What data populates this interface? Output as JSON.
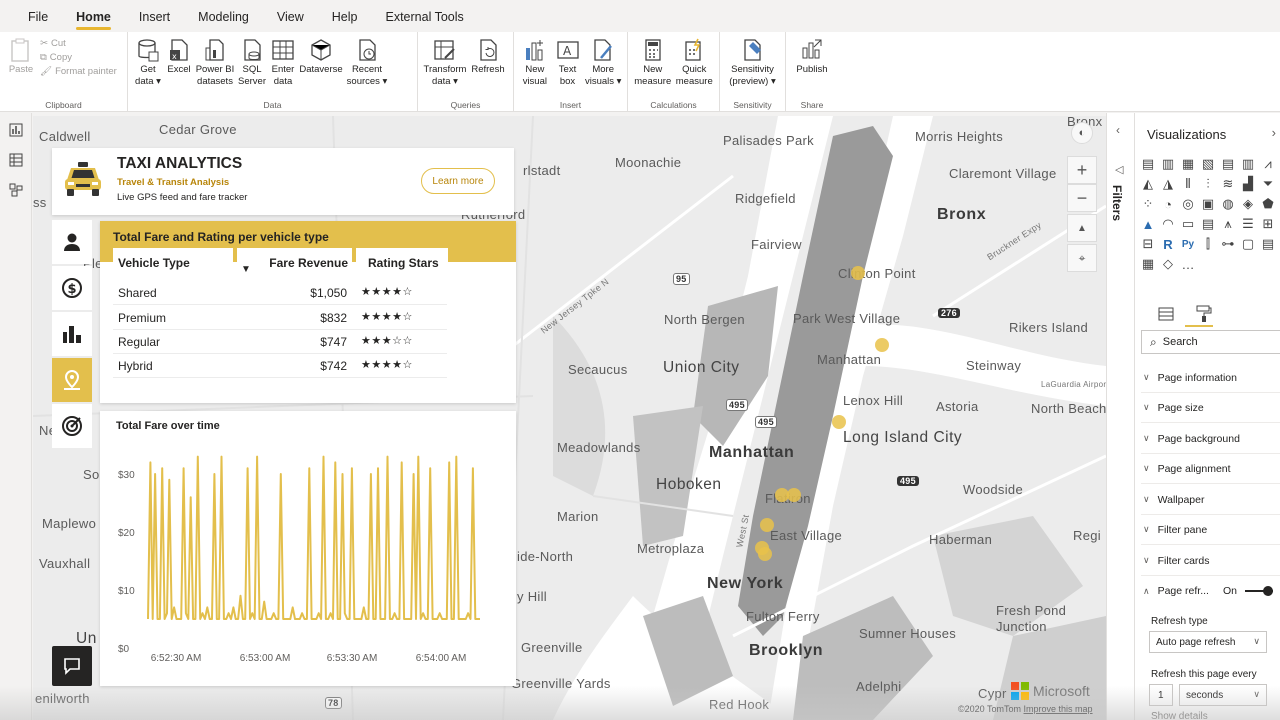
{
  "menu": {
    "tabs": [
      "File",
      "Home",
      "Insert",
      "Modeling",
      "View",
      "Help",
      "External Tools"
    ],
    "active": "Home"
  },
  "ribbon": {
    "clipboard": {
      "paste": "Paste",
      "cut": "Cut",
      "copy": "Copy",
      "format_painter": "Format painter",
      "label": "Clipboard"
    },
    "data": {
      "get_data": "Get\ndata ▾",
      "excel": "Excel",
      "power_bi": "Power BI\ndatasets",
      "sql": "SQL\nServer",
      "enter_data": "Enter\ndata",
      "dataverse": "Dataverse",
      "recent": "Recent\nsources ▾",
      "label": "Data"
    },
    "queries": {
      "transform": "Transform\ndata ▾",
      "refresh": "Refresh",
      "label": "Queries"
    },
    "insert": {
      "new_visual": "New\nvisual",
      "text_box": "Text\nbox",
      "more_visuals": "More\nvisuals ▾",
      "label": "Insert"
    },
    "calculations": {
      "new_measure": "New\nmeasure",
      "quick_measure": "Quick\nmeasure",
      "label": "Calculations"
    },
    "sensitivity": {
      "btn": "Sensitivity\n(preview) ▾",
      "label": "Sensitivity"
    },
    "share": {
      "publish": "Publish",
      "label": "Share"
    }
  },
  "map": {
    "labels": [
      {
        "text": "Caldwell",
        "cls": ""
      },
      {
        "text": "Cedar Grove",
        "cls": ""
      },
      {
        "text": "Palisades Park",
        "cls": ""
      },
      {
        "text": "Morris Heights",
        "cls": ""
      },
      {
        "text": "Bronx",
        "cls": "big"
      },
      {
        "text": "Moonachie",
        "cls": ""
      },
      {
        "text": "rlstadt",
        "cls": ""
      },
      {
        "text": "Ridgefield",
        "cls": ""
      },
      {
        "text": "Claremont Village",
        "cls": ""
      },
      {
        "text": "Rutherford",
        "cls": ""
      },
      {
        "text": "Fairview",
        "cls": ""
      },
      {
        "text": "Clinton Point",
        "cls": ""
      },
      {
        "text": "North Bergen",
        "cls": ""
      },
      {
        "text": "Park West Village",
        "cls": ""
      },
      {
        "text": "Rikers Island",
        "cls": ""
      },
      {
        "text": "Union City",
        "cls": "mid"
      },
      {
        "text": "Secaucus",
        "cls": ""
      },
      {
        "text": "Manhattan",
        "cls": ""
      },
      {
        "text": "Steinway",
        "cls": ""
      },
      {
        "text": "Lenox Hill",
        "cls": ""
      },
      {
        "text": "Astoria",
        "cls": ""
      },
      {
        "text": "North Beach",
        "cls": ""
      },
      {
        "text": "Long Island City",
        "cls": "mid"
      },
      {
        "text": "Meadowlands",
        "cls": ""
      },
      {
        "text": "Manhattan",
        "cls": "big"
      },
      {
        "text": "Hoboken",
        "cls": "mid"
      },
      {
        "text": "Flatiron",
        "cls": ""
      },
      {
        "text": "Woodside",
        "cls": ""
      },
      {
        "text": "Marion",
        "cls": ""
      },
      {
        "text": "East Village",
        "cls": ""
      },
      {
        "text": "Metroplaza",
        "cls": ""
      },
      {
        "text": "Haberman",
        "cls": ""
      },
      {
        "text": "ide-North",
        "cls": ""
      },
      {
        "text": "New York",
        "cls": "big"
      },
      {
        "text": "y Hill",
        "cls": ""
      },
      {
        "text": "Fulton Ferry",
        "cls": ""
      },
      {
        "text": "Fresh Pond\nJunction",
        "cls": ""
      },
      {
        "text": "Sumner Houses",
        "cls": ""
      },
      {
        "text": "Brooklyn",
        "cls": "big"
      },
      {
        "text": "Greenville",
        "cls": ""
      },
      {
        "text": "Greenville Yards",
        "cls": ""
      },
      {
        "text": "Adelphi",
        "cls": ""
      },
      {
        "text": "Red Hook",
        "cls": ""
      },
      {
        "text": "Maplewo",
        "cls": ""
      },
      {
        "text": "Vauxhall",
        "cls": ""
      },
      {
        "text": "Un",
        "cls": "mid"
      },
      {
        "text": "enilworth",
        "cls": ""
      },
      {
        "text": "So",
        "cls": ""
      },
      {
        "text": "Ne",
        "cls": ""
      },
      {
        "text": "Regi",
        "cls": ""
      },
      {
        "text": "Cypr",
        "cls": ""
      },
      {
        "text": "Bronx",
        "cls": ""
      },
      {
        "text": "ss",
        "cls": ""
      },
      {
        "text": "Ple",
        "cls": ""
      },
      {
        "text": "New Jersey Tpke N",
        "cls": "small"
      },
      {
        "text": "Bruckner Expy",
        "cls": "small"
      },
      {
        "text": "LaGuardia Airport",
        "cls": "small"
      },
      {
        "text": "West St",
        "cls": "small"
      }
    ],
    "shields": [
      "95",
      "276",
      "495",
      "495",
      "495",
      "78"
    ],
    "footer_copy": "©2020 TomTom",
    "footer_link": "Improve this map",
    "brand": "Microsoft",
    "zoom_in": "+",
    "zoom_out": "−"
  },
  "header_card": {
    "title": "TAXI ANALYTICS",
    "subtitle": "Travel & Transit Analysis",
    "desc": "Live GPS feed and fare tracker",
    "button": "Learn more"
  },
  "table": {
    "title": "Total Fare and Rating per vehicle type",
    "columns": [
      "Vehicle Type",
      "Fare Revenue",
      "Rating Stars"
    ],
    "rows": [
      {
        "type": "Shared",
        "revenue": "$1,050",
        "stars": "★★★★☆"
      },
      {
        "type": "Premium",
        "revenue": "$832",
        "stars": "★★★★☆"
      },
      {
        "type": "Regular",
        "revenue": "$747",
        "stars": "★★★☆☆"
      },
      {
        "type": "Hybrid",
        "revenue": "$742",
        "stars": "★★★★☆"
      }
    ]
  },
  "chart_data": {
    "type": "line",
    "title": "Total Fare over time",
    "xlabel": "",
    "ylabel": "",
    "x_ticks": [
      "6:52:30 AM",
      "6:53:00 AM",
      "6:53:30 AM",
      "6:54:00 AM"
    ],
    "y_ticks": [
      "$0",
      "$10",
      "$20",
      "$30"
    ],
    "ylim": [
      0,
      35
    ],
    "color": "#e3bf4c",
    "values": [
      5,
      32,
      5,
      30,
      5,
      5,
      31,
      5,
      6,
      29,
      5,
      7,
      5,
      5,
      5,
      31,
      6,
      5,
      26,
      5,
      5,
      33,
      5,
      6,
      5,
      7,
      5,
      5,
      30,
      5,
      5,
      33,
      5,
      5,
      6,
      5,
      7,
      5,
      5,
      9,
      5,
      5,
      31,
      5,
      6,
      5,
      33,
      5,
      5,
      8,
      5,
      5,
      5,
      6,
      5,
      5,
      30,
      5,
      5,
      5,
      5,
      7,
      5,
      5,
      5,
      6,
      5,
      5,
      31,
      5,
      5,
      5,
      6,
      5,
      33,
      5,
      5,
      6,
      5,
      32,
      5,
      5,
      30,
      6,
      5,
      5,
      31,
      5,
      5,
      5,
      5,
      7,
      5,
      5,
      30,
      5,
      5,
      31,
      5,
      5,
      5,
      33,
      5,
      5,
      6,
      5,
      5,
      32,
      5,
      5,
      5,
      5,
      30,
      5,
      33,
      5,
      6,
      5,
      5,
      31,
      5,
      5,
      5,
      6,
      5,
      5,
      5,
      32,
      5,
      5,
      33,
      5,
      5,
      5,
      5,
      6,
      5,
      31,
      5,
      5,
      5
    ]
  },
  "left_nav_icons": [
    "report-view-icon",
    "data-view-icon",
    "model-view-icon"
  ],
  "side_nav_icons": [
    "user-icon",
    "dollar-icon",
    "bar-chart-icon",
    "map-pin-icon",
    "target-icon"
  ],
  "filters": {
    "label": "Filters"
  },
  "viz_pane": {
    "title": "Visualizations",
    "search_placeholder": "Search",
    "sections": [
      "Page information",
      "Page size",
      "Page background",
      "Page alignment",
      "Wallpaper",
      "Filter pane",
      "Filter cards"
    ],
    "page_refresh": {
      "label": "Page refr...",
      "state": "On"
    },
    "refresh_type_label": "Refresh type",
    "refresh_type_value": "Auto page refresh",
    "refresh_every_label": "Refresh this page every",
    "refresh_every_value": "1",
    "refresh_every_unit": "seconds",
    "show_details": "Show details"
  },
  "colors": {
    "accent": "#e3bf4c",
    "water": "#ffffff",
    "land": "#ececec",
    "manhattan": "#9a9a9a"
  }
}
